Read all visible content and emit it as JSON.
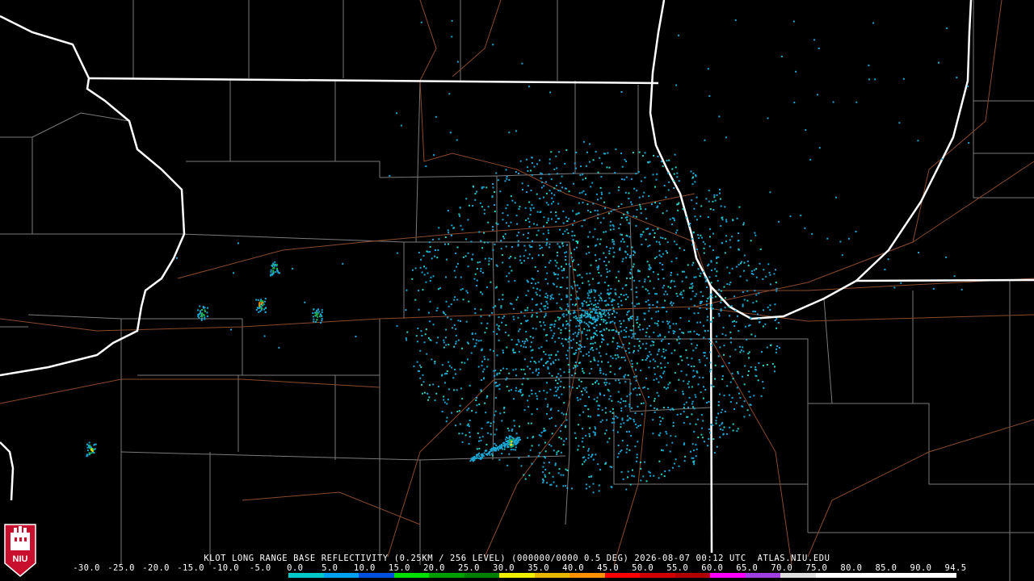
{
  "title": "KLOT LONG RANGE BASE REFLECTIVITY (0.25KM / 256 LEVEL) (000000/0000 0.5 DEG) 2026-08-07 00:12 UTC  ATLAS.NIU.EDU",
  "scale": {
    "ticks": [
      "-30.0",
      "-25.0",
      "-20.0",
      "-15.0",
      "-10.0",
      "-5.0",
      "0.0",
      "5.0",
      "10.0",
      "15.0",
      "20.0",
      "25.0",
      "30.0",
      "35.0",
      "40.0",
      "45.0",
      "50.0",
      "55.0",
      "60.0",
      "65.0",
      "70.0",
      "75.0",
      "80.0",
      "85.0",
      "90.0",
      "94.5"
    ],
    "colors": [
      "#000000",
      "#000000",
      "#000000",
      "#000000",
      "#000000",
      "#000000",
      "#00c8c8",
      "#00a0f0",
      "#0050e0",
      "#00e000",
      "#00a000",
      "#008000",
      "#f0f000",
      "#e8b800",
      "#ff9000",
      "#ff0000",
      "#d00000",
      "#b00000",
      "#ff00ff",
      "#a040e0",
      "#e0e0e0",
      "#ffffff",
      "#ffffff",
      "#ffffff",
      "#ffffff"
    ]
  },
  "logo_text": "NIU",
  "colors": {
    "background": "#000000",
    "state_lines": "#ffffff",
    "county_lines": "#7a7a7a",
    "roads": "#8b4a2b",
    "echo_light": "#1aa7d6",
    "echo_med": "#29d4c4",
    "echo_green": "#22b14c",
    "echo_yellow": "#f0e000",
    "echo_orange": "#ff8a00",
    "logo_red": "#c8102e"
  }
}
